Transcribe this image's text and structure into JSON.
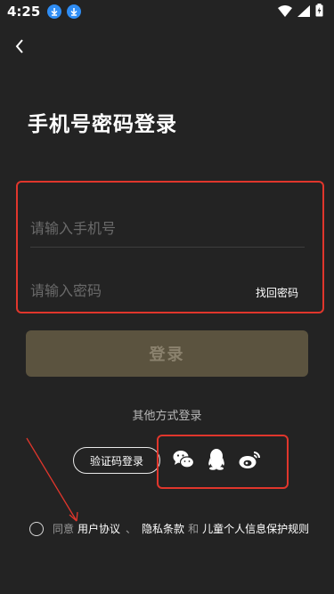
{
  "status_bar": {
    "time": "4:25"
  },
  "title": "手机号密码登录",
  "phone": {
    "placeholder": "请输入手机号",
    "value": ""
  },
  "password": {
    "placeholder": "请输入密码",
    "value": ""
  },
  "forgot_label": "找回密码",
  "login_label": "登录",
  "other_login_label": "其他方式登录",
  "code_login_label": "验证码登录",
  "social": [
    "wechat-icon",
    "qq-icon",
    "weibo-icon"
  ],
  "agreement": {
    "prefix": "同意",
    "user_agreement": "用户协议",
    "sep": "、",
    "privacy": "隐私条款",
    "and": "和",
    "children": "儿童个人信息保护规则"
  },
  "colors": {
    "background": "#232323",
    "login_button_bg": "#5b533f",
    "login_button_text": "#8b826e",
    "highlight": "#e0362c",
    "download_badge": "#2f8df4"
  }
}
